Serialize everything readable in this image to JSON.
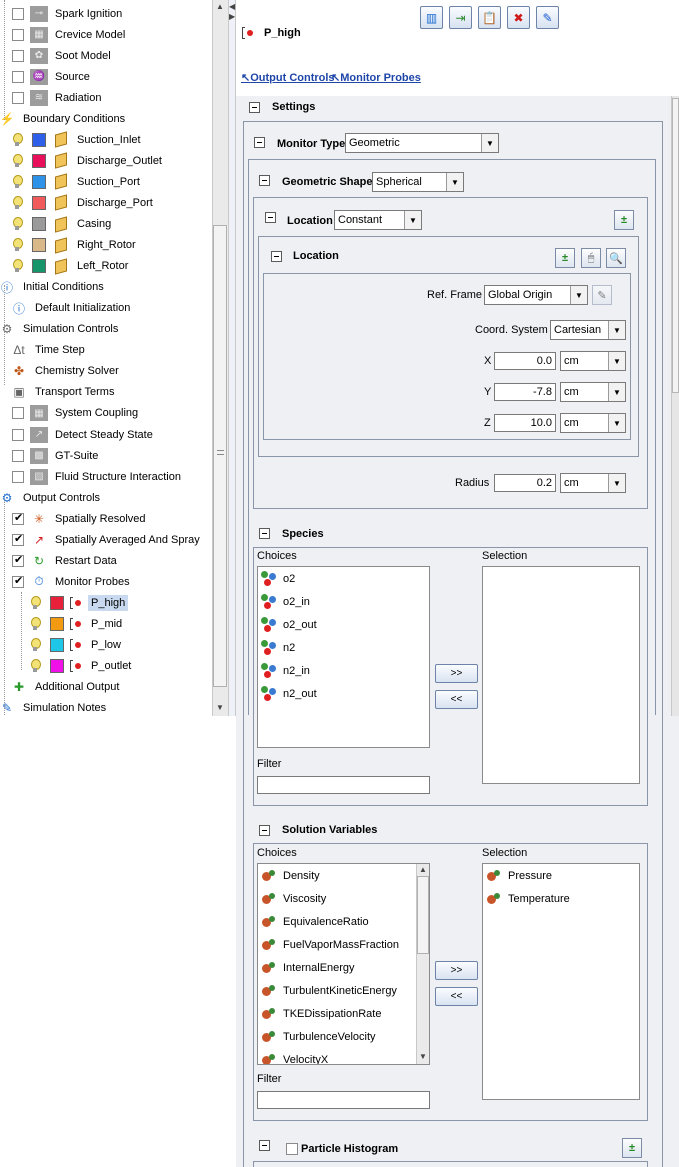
{
  "tree": {
    "items": [
      {
        "label": "Spark Ignition",
        "type": "cb",
        "checked": false,
        "icon": "spark-icon"
      },
      {
        "label": "Crevice Model",
        "type": "cb",
        "checked": false,
        "icon": "crevice-icon"
      },
      {
        "label": "Soot Model",
        "type": "cb",
        "checked": false,
        "icon": "soot-icon"
      },
      {
        "label": "Source",
        "type": "cb",
        "checked": false,
        "icon": "source-icon"
      },
      {
        "label": "Radiation",
        "type": "cb",
        "checked": false,
        "icon": "radiation-icon"
      },
      {
        "label": "Boundary Conditions",
        "type": "group",
        "icon": "boundary-icon"
      },
      {
        "label": "Suction_Inlet",
        "type": "bc",
        "color": "#2e5fe8"
      },
      {
        "label": "Discharge_Outlet",
        "type": "bc",
        "color": "#e8105a"
      },
      {
        "label": "Suction_Port",
        "type": "bc",
        "color": "#2e93e8"
      },
      {
        "label": "Discharge_Port",
        "type": "bc",
        "color": "#f05a5a"
      },
      {
        "label": "Casing",
        "type": "bc",
        "color": "#9a9a9a"
      },
      {
        "label": "Right_Rotor",
        "type": "bc",
        "color": "#d9b88a"
      },
      {
        "label": "Left_Rotor",
        "type": "bc",
        "color": "#17956a"
      },
      {
        "label": "Initial Conditions",
        "type": "group",
        "icon": "info-icon"
      },
      {
        "label": "Default Initialization",
        "type": "child",
        "icon": "info-icon"
      },
      {
        "label": "Simulation Controls",
        "type": "group",
        "icon": "controls-icon"
      },
      {
        "label": "Time Step",
        "type": "child",
        "icon": "delta-t-icon"
      },
      {
        "label": "Chemistry Solver",
        "type": "child",
        "icon": "chemistry-icon"
      },
      {
        "label": "Transport Terms",
        "type": "child",
        "icon": "transport-icon"
      },
      {
        "label": "System Coupling",
        "type": "cb",
        "checked": false,
        "icon": "coupling-icon"
      },
      {
        "label": "Detect Steady State",
        "type": "cb",
        "checked": false,
        "icon": "steady-state-icon"
      },
      {
        "label": "GT-Suite",
        "type": "cb",
        "checked": false,
        "icon": "gt-suite-icon"
      },
      {
        "label": "Fluid Structure Interaction",
        "type": "cb",
        "checked": false,
        "icon": "fsi-icon"
      },
      {
        "label": "Output Controls",
        "type": "group",
        "icon": "output-icon"
      },
      {
        "label": "Spatially Resolved",
        "type": "cb",
        "checked": true,
        "icon": "spatial-icon"
      },
      {
        "label": "Spatially Averaged And Spray",
        "type": "cb",
        "checked": true,
        "icon": "chart-line-icon"
      },
      {
        "label": "Restart Data",
        "type": "cb",
        "checked": true,
        "icon": "restart-icon"
      },
      {
        "label": "Monitor Probes",
        "type": "cb",
        "checked": true,
        "icon": "probe-icon"
      },
      {
        "label": "P_high",
        "type": "probe",
        "color": "#e8203a",
        "selected": true
      },
      {
        "label": "P_mid",
        "type": "probe",
        "color": "#f29a12"
      },
      {
        "label": "P_low",
        "type": "probe",
        "color": "#1ec6e8"
      },
      {
        "label": "P_outlet",
        "type": "probe",
        "color": "#f011e8"
      },
      {
        "label": "Additional Output",
        "type": "child",
        "icon": "additional-output-icon"
      },
      {
        "label": "Simulation Notes",
        "type": "group",
        "icon": "notes-icon"
      }
    ]
  },
  "header": {
    "probe_name": "P_high",
    "link_output": "Output Controls",
    "link_monitor": "Monitor Probes"
  },
  "settings": {
    "title": "Settings",
    "monitor_type_label": "Monitor Type",
    "monitor_type_value": "Geometric",
    "geometric_shape_label": "Geometric Shape",
    "geometric_shape_value": "Spherical",
    "location_label": "Location",
    "location_value": "Constant",
    "location_inner_title": "Location",
    "ref_frame_label": "Ref. Frame",
    "ref_frame_value": "Global Origin",
    "coord_system_label": "Coord. System",
    "coord_system_value": "Cartesian",
    "x_label": "X",
    "x_value": "0.0",
    "x_unit": "cm",
    "y_label": "Y",
    "y_value": "-7.8",
    "y_unit": "cm",
    "z_label": "Z",
    "z_value": "10.0",
    "z_unit": "cm",
    "radius_label": "Radius",
    "radius_value": "0.2",
    "radius_unit": "cm"
  },
  "species": {
    "title": "Species",
    "choices_label": "Choices",
    "selection_label": "Selection",
    "choices": [
      "o2",
      "o2_in",
      "o2_out",
      "n2",
      "n2_in",
      "n2_out"
    ],
    "selection": [],
    "add_label": ">>",
    "remove_label": "<<",
    "filter_label": "Filter"
  },
  "solution_variables": {
    "title": "Solution Variables",
    "choices_label": "Choices",
    "selection_label": "Selection",
    "choices": [
      "Density",
      "Viscosity",
      "EquivalenceRatio",
      "FuelVaporMassFraction",
      "InternalEnergy",
      "TurbulentKineticEnergy",
      "TKEDissipationRate",
      "TurbulenceVelocity",
      "VelocityX"
    ],
    "selection": [
      "Pressure",
      "Temperature"
    ],
    "add_label": ">>",
    "remove_label": "<<",
    "filter_label": "Filter"
  },
  "particle_histogram": {
    "title": "Particle Histogram"
  }
}
